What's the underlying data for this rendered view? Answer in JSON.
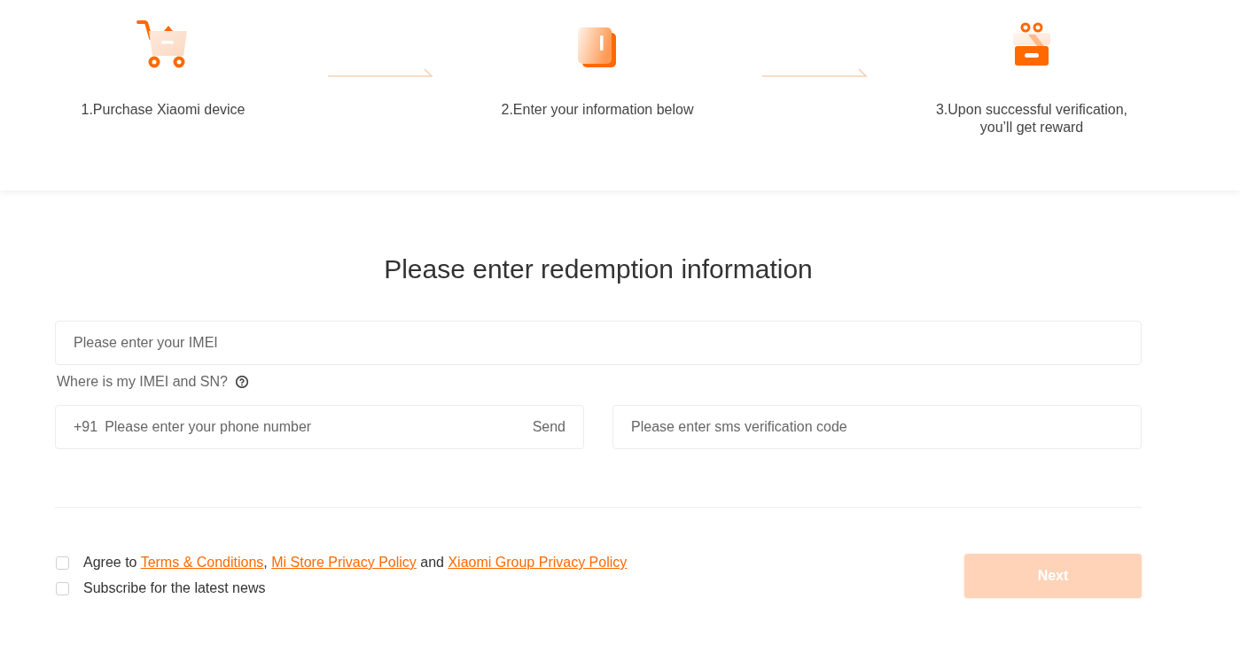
{
  "steps": [
    {
      "kind": "cart",
      "label": "1.Purchase Xiaomi device"
    },
    {
      "kind": "form",
      "label": "2.Enter your information below"
    },
    {
      "kind": "gift",
      "label": "3.Upon successful verification, you’ll get reward"
    }
  ],
  "form": {
    "title": "Please enter redemption information",
    "imei": {
      "placeholder": "Please enter your IMEI"
    },
    "help": {
      "label": "Where is my IMEI and SN?"
    },
    "phone": {
      "prefix": "+91",
      "placeholder": "Please enter your phone number",
      "send": "Send"
    },
    "sms": {
      "placeholder": "Please enter sms verification code"
    },
    "agreements": [
      {
        "checked": false,
        "parts": [
          {
            "kind": "text",
            "text": "Agree to "
          },
          {
            "kind": "link",
            "text": "Terms & Conditions"
          },
          {
            "kind": "text",
            "text": ", "
          },
          {
            "kind": "link",
            "text": "Mi Store Privacy Policy"
          },
          {
            "kind": "text",
            "text": " and "
          },
          {
            "kind": "link",
            "text": "Xiaomi Group Privacy Policy"
          }
        ]
      },
      {
        "checked": false,
        "parts": [
          {
            "kind": "text",
            "text": "Subscribe for the latest news"
          }
        ]
      }
    ],
    "next": {
      "label": "Next",
      "disabled": true
    }
  }
}
